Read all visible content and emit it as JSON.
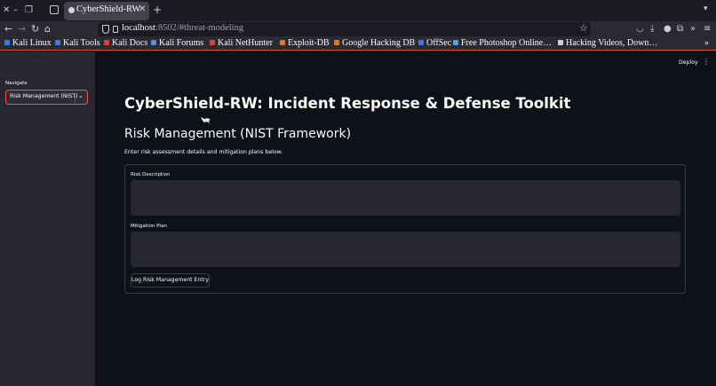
{
  "browser": {
    "tab_title": "CyberShield-RW",
    "url_host": "localhost",
    "url_rest": ":8502/#threat-modeling",
    "bookmarks": [
      {
        "label": "Kali Linux",
        "color": "#367bf0"
      },
      {
        "label": "Kali Tools",
        "color": "#3d7ad6"
      },
      {
        "label": "Kali Docs",
        "color": "#e0413a"
      },
      {
        "label": "Kali Forums",
        "color": "#5a8fd8"
      },
      {
        "label": "Kali NetHunter",
        "color": "#e03c3c"
      },
      {
        "label": "Exploit-DB",
        "color": "#e0762a"
      },
      {
        "label": "Google Hacking DB",
        "color": "#e0762a"
      },
      {
        "label": "OffSec",
        "color": "#4b6ee8"
      },
      {
        "label": "Free Photoshop Online…",
        "color": "#4fa3e6"
      },
      {
        "label": "Hacking Videos, Down…",
        "color": "#cfcfd8"
      }
    ]
  },
  "sidebar": {
    "nav_label": "Navigate",
    "selected": "Risk Management (NIST)"
  },
  "header": {
    "deploy_label": "Deploy"
  },
  "main": {
    "title": "CyberShield-RW: Incident Response & Defense Toolkit",
    "subtitle": "Risk Management (NIST Framework)",
    "caption": "Enter risk assessment details and mitigation plans below.",
    "form": {
      "risk_label": "Risk Description",
      "risk_value": "",
      "mitigation_label": "Mitigation Plan",
      "mitigation_value": "",
      "submit_label": "Log Risk Management Entry"
    }
  },
  "colors": {
    "accent": "#ff4b4b",
    "background": "#0e1117",
    "sidebar": "#262730"
  }
}
